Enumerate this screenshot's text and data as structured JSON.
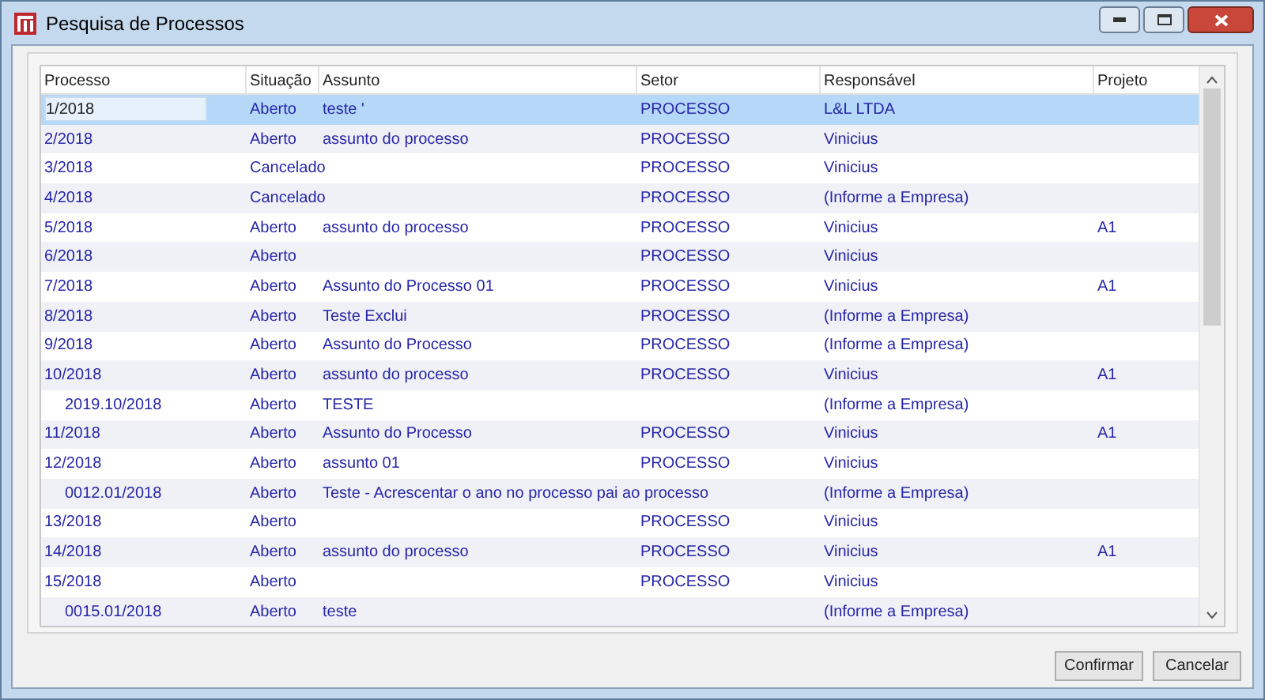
{
  "window": {
    "title": "Pesquisa de Processos"
  },
  "table": {
    "columns": [
      "Processo",
      "Situação",
      "Assunto",
      "Setor",
      "Responsável",
      "Projeto"
    ],
    "rows": [
      {
        "selected": true,
        "cells": [
          "1/2018",
          "Aberto",
          "teste '",
          "PROCESSO",
          "L&L LTDA",
          ""
        ]
      },
      {
        "selected": false,
        "cells": [
          "2/2018",
          "Aberto",
          "assunto do processo",
          "PROCESSO",
          "Vinicius",
          ""
        ]
      },
      {
        "selected": false,
        "cells": [
          "3/2018",
          "Cancelado",
          "",
          "PROCESSO",
          "Vinicius",
          ""
        ]
      },
      {
        "selected": false,
        "cells": [
          "4/2018",
          "Cancelado",
          "",
          "PROCESSO",
          "(Informe a Empresa)",
          ""
        ]
      },
      {
        "selected": false,
        "cells": [
          "5/2018",
          "Aberto",
          "assunto do processo",
          "PROCESSO",
          "Vinicius",
          "A1"
        ]
      },
      {
        "selected": false,
        "cells": [
          "6/2018",
          "Aberto",
          "",
          "PROCESSO",
          "Vinicius",
          ""
        ]
      },
      {
        "selected": false,
        "cells": [
          "7/2018",
          "Aberto",
          "Assunto do Processo 01",
          "PROCESSO",
          "Vinicius",
          "A1"
        ]
      },
      {
        "selected": false,
        "cells": [
          "8/2018",
          "Aberto",
          "Teste Exclui",
          "PROCESSO",
          "(Informe a Empresa)",
          ""
        ]
      },
      {
        "selected": false,
        "cells": [
          "9/2018",
          "Aberto",
          "Assunto do Processo",
          "PROCESSO",
          "(Informe a Empresa)",
          ""
        ]
      },
      {
        "selected": false,
        "cells": [
          "10/2018",
          "Aberto",
          "assunto do processo",
          "PROCESSO",
          "Vinicius",
          "A1"
        ],
        "children": [
          {
            "selected": false,
            "cells": [
              "2019.10/2018",
              "Aberto",
              "TESTE",
              "",
              "(Informe a Empresa)",
              ""
            ]
          }
        ]
      },
      {
        "selected": false,
        "cells": [
          "11/2018",
          "Aberto",
          "Assunto do Processo",
          "PROCESSO",
          "Vinicius",
          "A1"
        ]
      },
      {
        "selected": false,
        "cells": [
          "12/2018",
          "Aberto",
          "assunto 01",
          "PROCESSO",
          "Vinicius",
          ""
        ],
        "children": [
          {
            "selected": false,
            "cells": [
              "0012.01/2018",
              "Aberto",
              "Teste - Acrescentar o ano no processo pai ao processo",
              "",
              "(Informe a Empresa)",
              ""
            ]
          }
        ]
      },
      {
        "selected": false,
        "cells": [
          "13/2018",
          "Aberto",
          "",
          "PROCESSO",
          "Vinicius",
          ""
        ]
      },
      {
        "selected": false,
        "cells": [
          "14/2018",
          "Aberto",
          "assunto do processo",
          "PROCESSO",
          "Vinicius",
          "A1"
        ]
      },
      {
        "selected": false,
        "cells": [
          "15/2018",
          "Aberto",
          "",
          "PROCESSO",
          "Vinicius",
          ""
        ],
        "children": [
          {
            "selected": false,
            "cells": [
              "0015.01/2018",
              "Aberto",
              "teste",
              "",
              "(Informe a Empresa)",
              ""
            ]
          }
        ]
      }
    ]
  },
  "buttons": [
    "Confirmar",
    "Cancelar"
  ]
}
